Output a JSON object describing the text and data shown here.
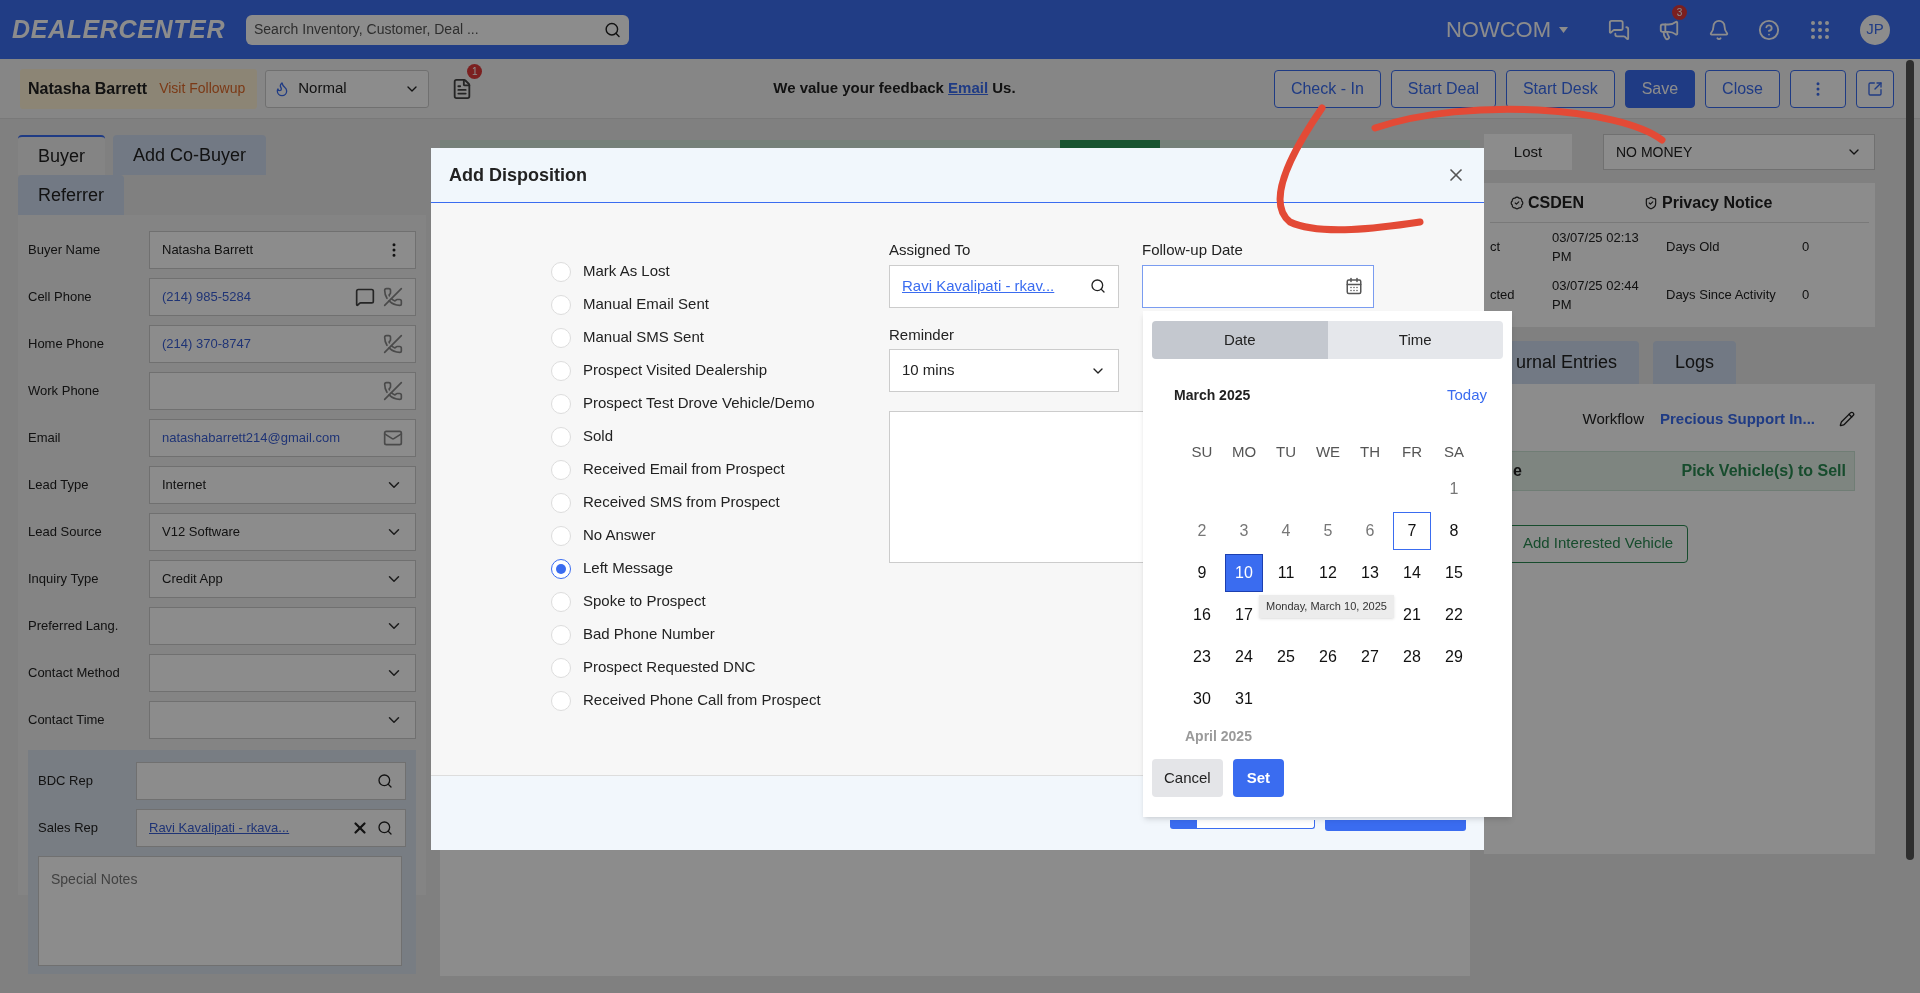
{
  "header": {
    "logo": "DEALERCENTER",
    "search": {
      "placeholder": "Search Inventory, Customer, Deal ..."
    },
    "dealer": "NOWCOM",
    "alerts_badge": "3",
    "avatar": "JP"
  },
  "customer_bar": {
    "name": "Natasha Barrett",
    "status": "Visit Followup",
    "priority": "Normal",
    "docs_badge": "1",
    "feedback": "We value your feedback",
    "feedback_link": "Email",
    "feedback_end": "Us.",
    "actions": [
      {
        "kind": "outline",
        "label": "Check - In"
      },
      {
        "kind": "outline",
        "label": "Start Deal"
      },
      {
        "kind": "outline",
        "label": "Start Desk"
      },
      {
        "kind": "primary",
        "label": "Save"
      },
      {
        "kind": "outline",
        "label": "Close"
      },
      {
        "kind": "more"
      },
      {
        "kind": "external"
      }
    ]
  },
  "buyer_panel": {
    "tabs": [
      {
        "label": "Buyer",
        "selected": true
      },
      {
        "label": "Add Co-Buyer",
        "selected": false
      },
      {
        "label": "Referrer",
        "selected": false
      }
    ],
    "fields": [
      {
        "label": "Buyer Name",
        "value": "Natasha Barrett",
        "kind": "name"
      },
      {
        "label": "Cell Phone",
        "value": "(214) 985-5284",
        "kind": "cell"
      },
      {
        "label": "Home Phone",
        "value": "(214) 370-8747",
        "kind": "phone"
      },
      {
        "label": "Work Phone",
        "kind": "phone"
      },
      {
        "label": "Email",
        "value": "natashabarrett214@gmail.com",
        "kind": "email"
      },
      {
        "label": "Lead Type",
        "value": "Internet",
        "kind": "select"
      },
      {
        "label": "Lead Source",
        "value": "V12 Software",
        "kind": "select"
      },
      {
        "label": "Inquiry Type",
        "value": "Credit App",
        "kind": "select"
      },
      {
        "label": "Preferred Lang.",
        "kind": "select"
      },
      {
        "label": "Contact Method",
        "kind": "select"
      },
      {
        "label": "Contact Time",
        "kind": "select"
      }
    ],
    "reps": [
      {
        "label": "BDC Rep"
      },
      {
        "label": "Sales Rep",
        "value": "Ravi Kavalipati - rkava..."
      }
    ],
    "notes": {
      "placeholder": "Special Notes"
    }
  },
  "right_panel": {
    "stage": "Lost",
    "lost_reason": "NO MONEY",
    "info": {
      "badges": [
        "CSDEN",
        "Privacy Notice"
      ],
      "rows": [
        {
          "label": "ct",
          "date": "03/07/25 02:13 PM",
          "stat": "Days Old",
          "value": "0"
        },
        {
          "label": "cted",
          "date": "03/07/25 02:44 PM",
          "stat": "Days Since Activity",
          "value": "0"
        }
      ]
    },
    "tabs": [
      {
        "label": "urnal Entries",
        "selected": false
      },
      {
        "label": "Logs",
        "selected": false
      }
    ],
    "workflow": {
      "label": "Workflow",
      "value": "Precious Support In..."
    },
    "vehicles": {
      "title": "e",
      "action": "Pick Vehicle(s) to Sell",
      "button": "Add Interested Vehicle"
    }
  },
  "modal": {
    "title": "Add Disposition",
    "dispositions": [
      {
        "label": "Mark As Lost",
        "selected": false
      },
      {
        "label": "Manual Email Sent",
        "selected": false
      },
      {
        "label": "Manual SMS Sent",
        "selected": false
      },
      {
        "label": "Prospect Visited Dealership",
        "selected": false
      },
      {
        "label": "Prospect Test Drove Vehicle/Demo",
        "selected": false
      },
      {
        "label": "Sold",
        "selected": false
      },
      {
        "label": "Received Email from Prospect",
        "selected": false
      },
      {
        "label": "Received SMS from Prospect",
        "selected": false
      },
      {
        "label": "No Answer",
        "selected": false
      },
      {
        "label": "Left Message",
        "selected": true
      },
      {
        "label": "Spoke to Prospect",
        "selected": false
      },
      {
        "label": "Bad Phone Number",
        "selected": false
      },
      {
        "label": "Prospect Requested DNC",
        "selected": false
      },
      {
        "label": "Received Phone Call from Prospect",
        "selected": false
      }
    ],
    "assigned_to": {
      "label": "Assigned To",
      "value": "Ravi Kavalipati - rkav..."
    },
    "reminder": {
      "label": "Reminder",
      "value": "10 mins"
    },
    "follow_up": {
      "label": "Follow-up Date"
    },
    "date_picker": {
      "tabs": [
        {
          "label": "Date",
          "selected": true
        },
        {
          "label": "Time",
          "selected": false
        }
      ],
      "month": "March 2025",
      "today_link": "Today",
      "weekdays": [
        "SU",
        "MO",
        "TU",
        "WE",
        "TH",
        "FR",
        "SA"
      ],
      "days": [
        {
          "kind": "blank"
        },
        {
          "kind": "blank"
        },
        {
          "kind": "blank"
        },
        {
          "kind": "blank"
        },
        {
          "kind": "blank"
        },
        {
          "kind": "blank"
        },
        {
          "kind": "day",
          "label": "1",
          "past": true,
          "today": false,
          "selected": false
        },
        {
          "kind": "day",
          "label": "2",
          "past": true,
          "today": false,
          "selected": false
        },
        {
          "kind": "day",
          "label": "3",
          "past": true,
          "today": false,
          "selected": false
        },
        {
          "kind": "day",
          "label": "4",
          "past": true,
          "today": false,
          "selected": false
        },
        {
          "kind": "day",
          "label": "5",
          "past": true,
          "today": false,
          "selected": false
        },
        {
          "kind": "day",
          "label": "6",
          "past": true,
          "today": false,
          "selected": false
        },
        {
          "kind": "day",
          "label": "7",
          "past": false,
          "today": true,
          "selected": false
        },
        {
          "kind": "day",
          "label": "8",
          "past": false,
          "today": false,
          "selected": false
        },
        {
          "kind": "day",
          "label": "9",
          "past": false,
          "today": false,
          "selected": false
        },
        {
          "kind": "day",
          "label": "10",
          "past": false,
          "today": false,
          "selected": true
        },
        {
          "kind": "day",
          "label": "11",
          "past": false,
          "today": false,
          "selected": false
        },
        {
          "kind": "day",
          "label": "12",
          "past": false,
          "today": false,
          "selected": false
        },
        {
          "kind": "day",
          "label": "13",
          "past": false,
          "today": false,
          "selected": false
        },
        {
          "kind": "day",
          "label": "14",
          "past": false,
          "today": false,
          "selected": false
        },
        {
          "kind": "day",
          "label": "15",
          "past": false,
          "today": false,
          "selected": false
        },
        {
          "kind": "day",
          "label": "16",
          "past": false,
          "today": false,
          "selected": false
        },
        {
          "kind": "day",
          "label": "17",
          "past": false,
          "today": false,
          "selected": false
        },
        {
          "kind": "blank"
        },
        {
          "kind": "blank"
        },
        {
          "kind": "blank"
        },
        {
          "kind": "day",
          "label": "21",
          "past": false,
          "today": false,
          "selected": false
        },
        {
          "kind": "day",
          "label": "22",
          "past": false,
          "today": false,
          "selected": false
        },
        {
          "kind": "day",
          "label": "23",
          "past": false,
          "today": false,
          "selected": false
        },
        {
          "kind": "day",
          "label": "24",
          "past": false,
          "today": false,
          "selected": false
        },
        {
          "kind": "day",
          "label": "25",
          "past": false,
          "today": false,
          "selected": false
        },
        {
          "kind": "day",
          "label": "26",
          "past": false,
          "today": false,
          "selected": false
        },
        {
          "kind": "day",
          "label": "27",
          "past": false,
          "today": false,
          "selected": false
        },
        {
          "kind": "day",
          "label": "28",
          "past": false,
          "today": false,
          "selected": false
        },
        {
          "kind": "day",
          "label": "29",
          "past": false,
          "today": false,
          "selected": false
        },
        {
          "kind": "day",
          "label": "30",
          "past": false,
          "today": false,
          "selected": false
        },
        {
          "kind": "day",
          "label": "31",
          "past": false,
          "today": false,
          "selected": false
        }
      ],
      "tooltip": "Monday, March 10, 2025",
      "next_month": "April 2025",
      "buttons": [
        {
          "kind": "secondary",
          "label": "Cancel"
        },
        {
          "kind": "primary",
          "label": "Set"
        }
      ]
    }
  }
}
